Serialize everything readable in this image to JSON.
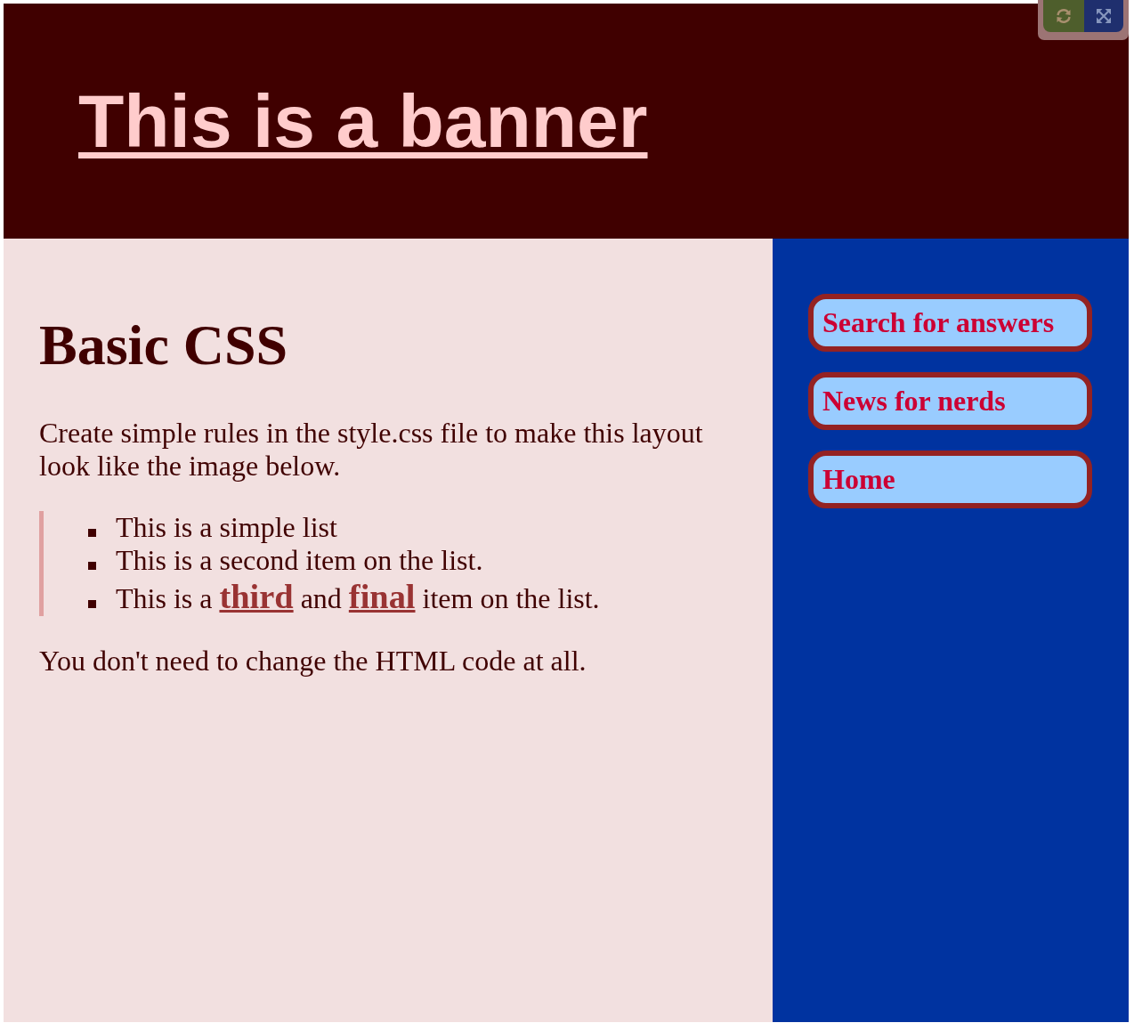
{
  "banner": {
    "title": "This is a banner"
  },
  "main": {
    "heading": "Basic CSS",
    "intro": "Create simple rules in the style.css file to make this layout look like the image below.",
    "list": [
      {
        "segments": [
          {
            "kind": "text",
            "text": "This is a simple list"
          }
        ]
      },
      {
        "segments": [
          {
            "kind": "text",
            "text": "This is a second item on the list."
          }
        ]
      },
      {
        "segments": [
          {
            "kind": "text",
            "text": "This is a "
          },
          {
            "kind": "link",
            "text": "third"
          },
          {
            "kind": "text",
            "text": " and "
          },
          {
            "kind": "link",
            "text": "final"
          },
          {
            "kind": "text",
            "text": " item on the list."
          }
        ]
      }
    ],
    "closing": "You don't need to change the HTML code at all."
  },
  "sidebar": {
    "links": [
      {
        "label": "Search for answers"
      },
      {
        "label": "News for nerds"
      },
      {
        "label": "Home"
      }
    ]
  }
}
